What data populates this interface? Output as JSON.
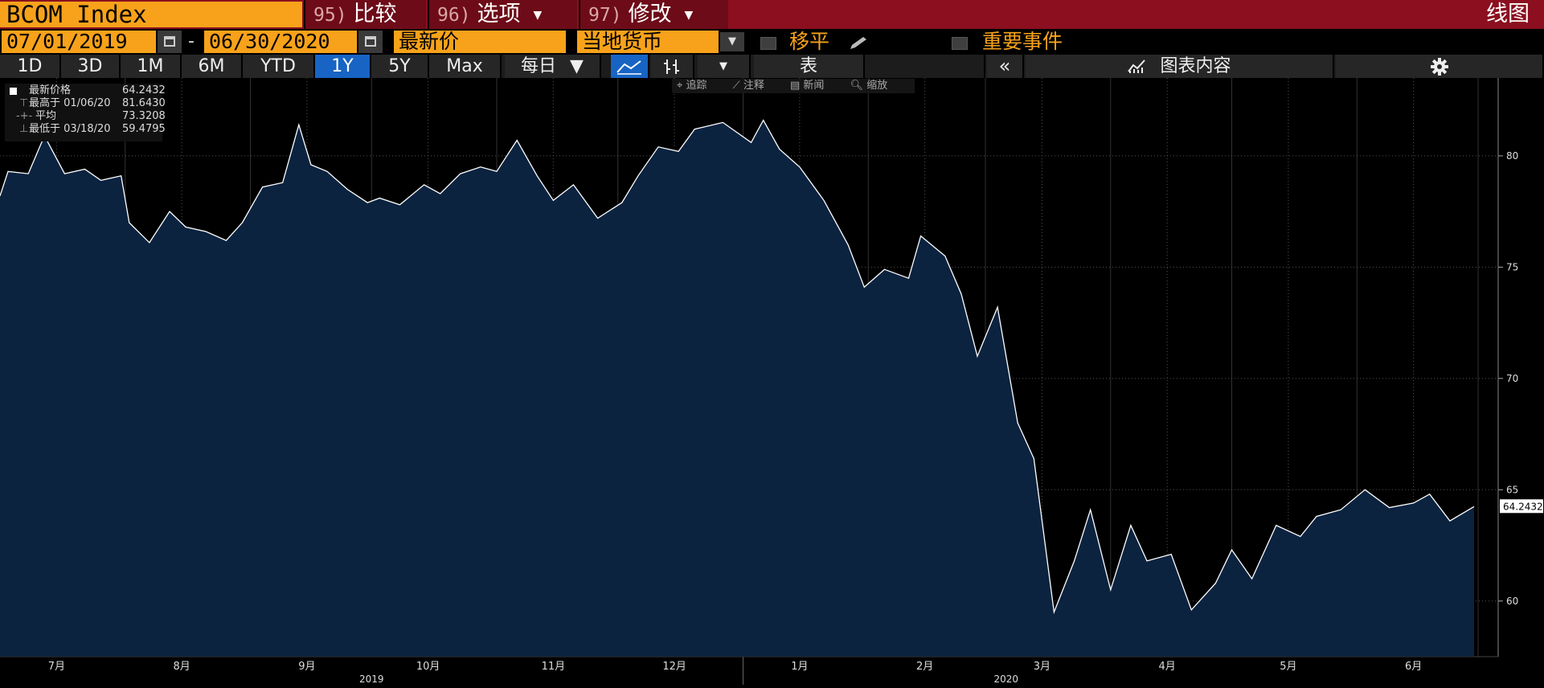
{
  "header": {
    "ticker": "BCOM Index",
    "buttons": [
      {
        "num": "95)",
        "label": "比较"
      },
      {
        "num": "96)",
        "label": "选项"
      },
      {
        "num": "97)",
        "label": "修改"
      }
    ],
    "chart_label": "线图"
  },
  "range": {
    "start": "07/01/2019",
    "dash": "-",
    "end": "06/30/2020",
    "field": "最新价",
    "currency": "当地货币",
    "moving_avg": "移平",
    "events": "重要事件"
  },
  "toolbar": {
    "periods": [
      "1D",
      "3D",
      "1M",
      "6M",
      "YTD",
      "1Y",
      "5Y",
      "Max"
    ],
    "selected_period": "1Y",
    "frequency": "每日",
    "table": "表",
    "chart_contents": "图表内容"
  },
  "chart_tools": [
    "追踪",
    "注释",
    "新闻",
    "缩放"
  ],
  "legend": {
    "last_label": "最新价格",
    "last_value": "64.2432",
    "high_label": "最高于 01/06/20",
    "high_value": "81.6430",
    "avg_label": "平均",
    "avg_value": "73.3208",
    "low_label": "最低于 03/18/20",
    "low_value": "59.4795"
  },
  "colors": {
    "header_bg": "#8b0f1f",
    "accent_orange": "#f7a21a",
    "selected_blue": "#1764c4",
    "area_fill": "#0c2340",
    "line": "#ffffff"
  },
  "chart_data": {
    "type": "area",
    "x": [
      "2019-07-01",
      "2019-07-03",
      "2019-07-08",
      "2019-07-12",
      "2019-07-17",
      "2019-07-22",
      "2019-07-26",
      "2019-07-31",
      "2019-08-02",
      "2019-08-07",
      "2019-08-12",
      "2019-08-16",
      "2019-08-21",
      "2019-08-26",
      "2019-08-30",
      "2019-09-04",
      "2019-09-09",
      "2019-09-13",
      "2019-09-16",
      "2019-09-20",
      "2019-09-25",
      "2019-09-30",
      "2019-10-03",
      "2019-10-08",
      "2019-10-14",
      "2019-10-18",
      "2019-10-23",
      "2019-10-28",
      "2019-11-01",
      "2019-11-06",
      "2019-11-11",
      "2019-11-15",
      "2019-11-20",
      "2019-11-26",
      "2019-12-02",
      "2019-12-06",
      "2019-12-11",
      "2019-12-16",
      "2019-12-20",
      "2019-12-27",
      "2020-01-03",
      "2020-01-06",
      "2020-01-10",
      "2020-01-15",
      "2020-01-21",
      "2020-01-27",
      "2020-01-31",
      "2020-02-05",
      "2020-02-11",
      "2020-02-14",
      "2020-02-20",
      "2020-02-24",
      "2020-02-28",
      "2020-03-04",
      "2020-03-09",
      "2020-03-13",
      "2020-03-18",
      "2020-03-23",
      "2020-03-27",
      "2020-04-01",
      "2020-04-06",
      "2020-04-10",
      "2020-04-16",
      "2020-04-21",
      "2020-04-27",
      "2020-05-01",
      "2020-05-06",
      "2020-05-12",
      "2020-05-18",
      "2020-05-22",
      "2020-05-28",
      "2020-06-03",
      "2020-06-09",
      "2020-06-15",
      "2020-06-19",
      "2020-06-24",
      "2020-06-30"
    ],
    "values": [
      78.2,
      79.3,
      79.2,
      80.9,
      79.2,
      79.4,
      78.9,
      79.1,
      77.0,
      76.1,
      77.5,
      76.8,
      76.6,
      76.2,
      77.0,
      78.6,
      78.8,
      81.4,
      79.6,
      79.3,
      78.5,
      77.9,
      78.1,
      77.8,
      78.7,
      78.3,
      79.2,
      79.5,
      79.3,
      80.7,
      79.1,
      78.0,
      78.7,
      77.2,
      77.9,
      79.1,
      80.4,
      80.2,
      81.2,
      81.5,
      80.6,
      81.6,
      80.3,
      79.5,
      78.0,
      76.0,
      74.1,
      74.9,
      74.5,
      76.4,
      75.5,
      73.8,
      71.0,
      73.2,
      68.0,
      66.4,
      59.5,
      61.8,
      64.1,
      60.5,
      63.4,
      61.8,
      62.1,
      59.6,
      60.8,
      62.3,
      61.0,
      63.4,
      62.9,
      63.8,
      64.1,
      65.0,
      64.2,
      64.4,
      64.8,
      63.6,
      64.2432
    ],
    "xticks": [
      "7月",
      "8月",
      "9月",
      "10月",
      "11月",
      "12月",
      "1月",
      "2月",
      "3月",
      "4月",
      "5月",
      "6月"
    ],
    "year_labels": [
      "2019",
      "2020"
    ],
    "yticks": [
      60,
      65,
      70,
      75,
      80
    ],
    "ylim": [
      57.5,
      83.5
    ],
    "last_value_label": "64.2432",
    "grid": true
  }
}
